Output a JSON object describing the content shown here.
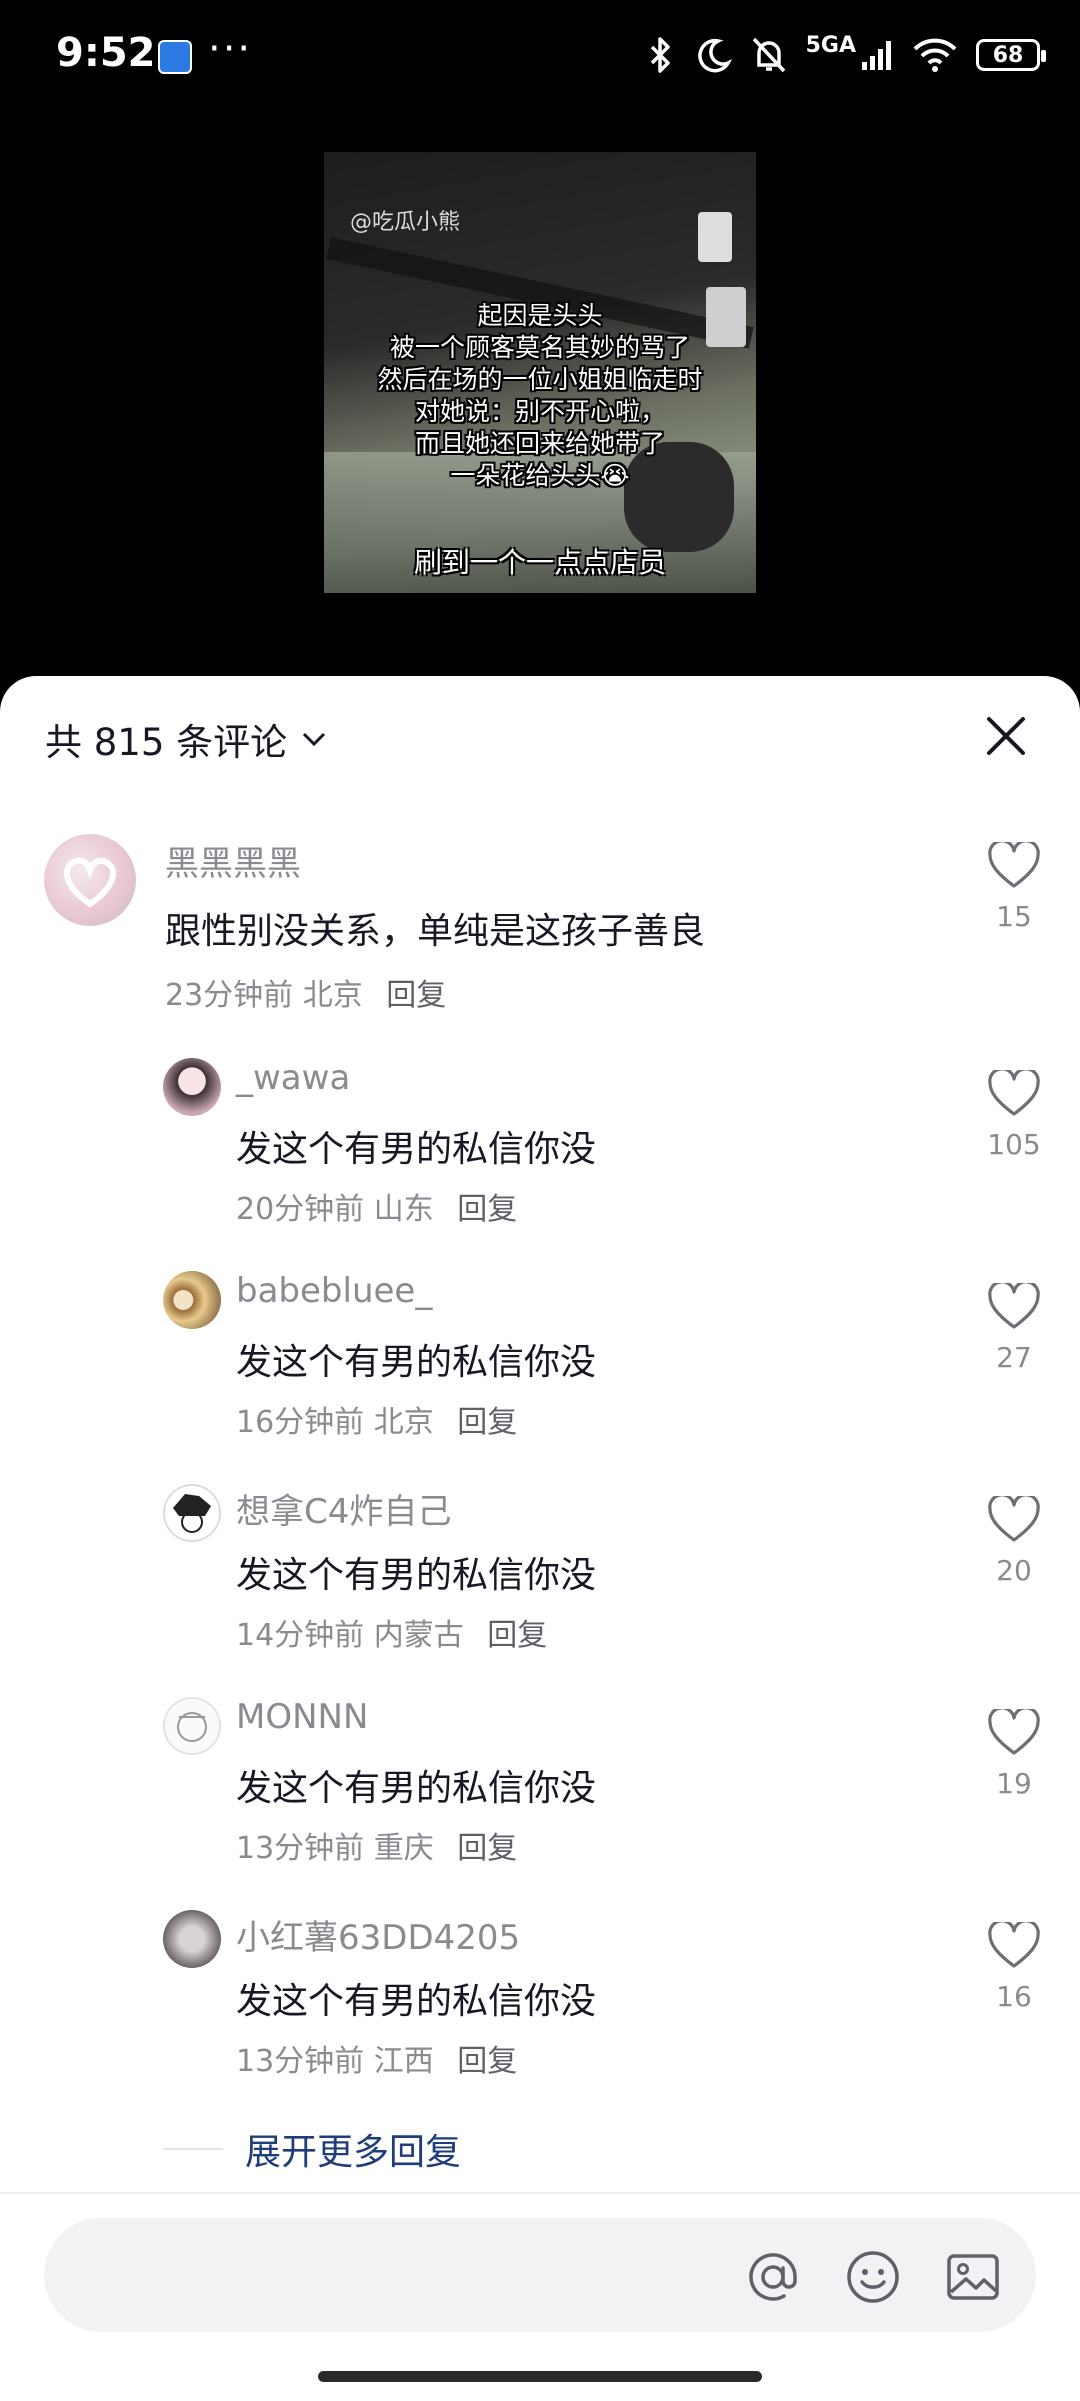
{
  "status_bar": {
    "time": "9:52",
    "network": "5GA",
    "battery": "68"
  },
  "video": {
    "watermark": "@吃瓜小熊",
    "caption_lines": [
      "起因是头头",
      "被一个顾客莫名其妙的骂了",
      "然后在场的一位小姐姐临走时",
      "对她说：别不开心啦，",
      "而且她还回来给她带了",
      "一朵花给头头😭"
    ],
    "bottom_caption": "刷到一个一点点店员"
  },
  "comments_header": {
    "count_text": "共 815 条评论"
  },
  "comments": [
    {
      "user": "黑黑黑黑",
      "text": "跟性别没关系，单纯是这孩子善良",
      "time": "23分钟前",
      "location": "北京",
      "reply": "回复",
      "likes": "15"
    },
    {
      "user": "_wawa",
      "text": "发这个有男的私信你没",
      "time": "20分钟前",
      "location": "山东",
      "reply": "回复",
      "likes": "105"
    },
    {
      "user": "babebluee_",
      "text": "发这个有男的私信你没",
      "time": "16分钟前",
      "location": "北京",
      "reply": "回复",
      "likes": "27"
    },
    {
      "user": "想拿C4炸自己",
      "text": "发这个有男的私信你没",
      "time": "14分钟前",
      "location": "内蒙古",
      "reply": "回复",
      "likes": "20"
    },
    {
      "user": "MONNN",
      "text": "发这个有男的私信你没",
      "time": "13分钟前",
      "location": "重庆",
      "reply": "回复",
      "likes": "19"
    },
    {
      "user": "小红薯63DD4205",
      "text": "发这个有男的私信你没",
      "time": "13分钟前",
      "location": "江西",
      "reply": "回复",
      "likes": "16"
    }
  ],
  "expand_more": "展开更多回复",
  "input": {
    "placeholder": ""
  },
  "icons": [
    "close-icon",
    "chevron-down-icon",
    "heart-icon",
    "at-icon",
    "emoji-icon",
    "image-icon"
  ]
}
